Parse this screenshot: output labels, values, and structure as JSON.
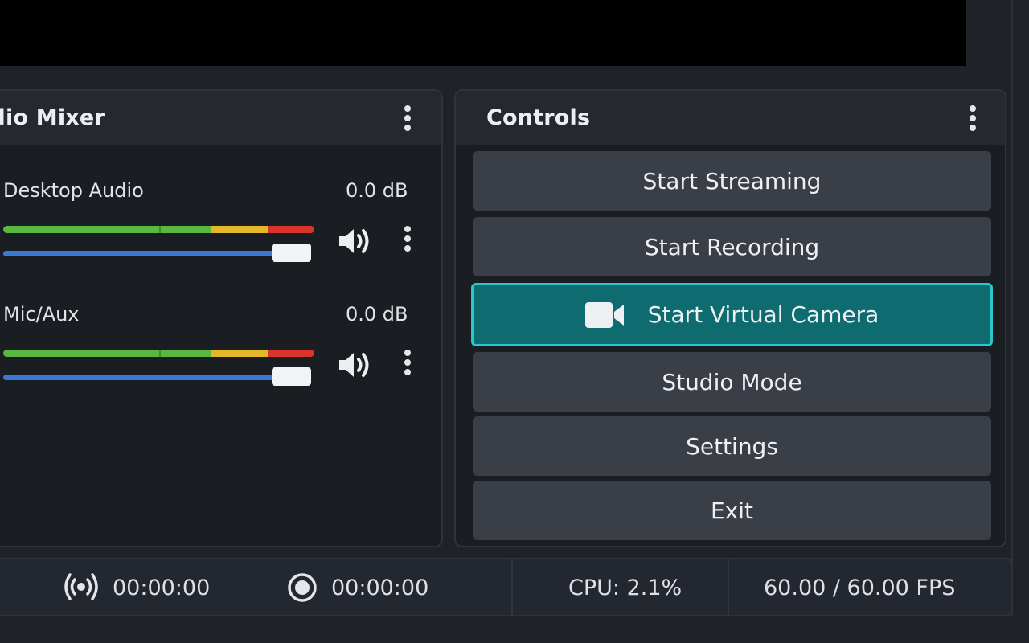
{
  "mixer": {
    "title": "udio Mixer",
    "menu_icon": "kebab-menu-icon",
    "channels": [
      {
        "name": "Desktop Audio",
        "db": "0.0 dB",
        "volume": 0.95,
        "icon": "speaker-icon"
      },
      {
        "name": "Mic/Aux",
        "db": "0.0 dB",
        "volume": 0.95,
        "icon": "speaker-icon"
      }
    ],
    "meter_colors": {
      "green": "#58b840",
      "yellow": "#e4b929",
      "red": "#d9332b"
    },
    "slider_color": "#3b78d4"
  },
  "controls": {
    "title": "Controls",
    "menu_icon": "kebab-menu-icon",
    "buttons": [
      {
        "label": "Start Streaming"
      },
      {
        "label": "Start Recording"
      },
      {
        "label": "Start Virtual Camera",
        "icon": "video-camera-icon",
        "active": true
      },
      {
        "label": "Studio Mode"
      },
      {
        "label": "Settings"
      },
      {
        "label": "Exit"
      }
    ],
    "accent_color": "#0e6b6f",
    "accent_border": "#27c9cb"
  },
  "status": {
    "stream_icon": "broadcast-icon",
    "stream_time": "00:00:00",
    "record_icon": "record-icon",
    "record_time": "00:00:00",
    "cpu": "CPU: 2.1%",
    "fps": "60.00 / 60.00 FPS"
  }
}
